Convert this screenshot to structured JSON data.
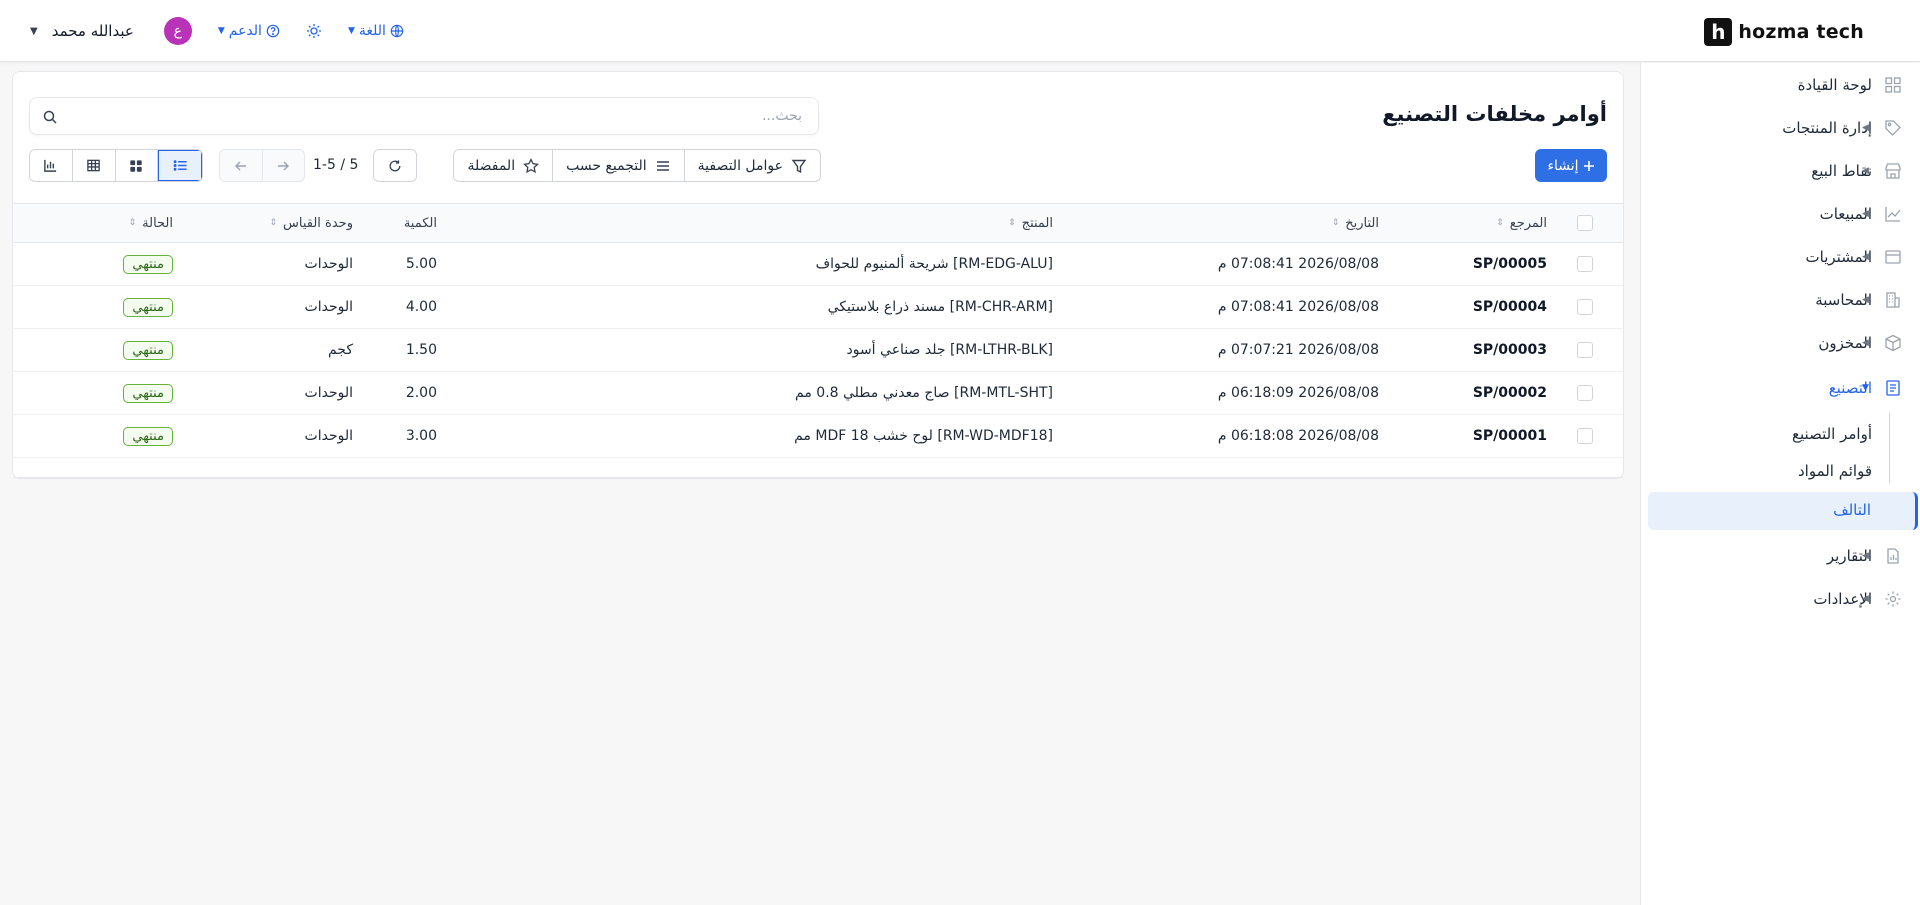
{
  "brand": {
    "logo_letter": "h",
    "name": "hozma tech"
  },
  "topbar": {
    "user_name": "عبدالله محمد",
    "avatar_letter": "ع",
    "support_label": "الدعم",
    "language_label": "اللغة"
  },
  "sidebar": {
    "items": [
      {
        "label": "لوحة القيادة",
        "icon": "grid-icon"
      },
      {
        "label": "إدارة المنتجات",
        "icon": "tag-icon"
      },
      {
        "label": "نقاط البيع",
        "icon": "store-icon"
      },
      {
        "label": "المبيعات",
        "icon": "chart-line-icon"
      },
      {
        "label": "المشتريات",
        "icon": "wallet-icon"
      },
      {
        "label": "المحاسبة",
        "icon": "building-icon"
      },
      {
        "label": "المخزون",
        "icon": "box-icon"
      },
      {
        "label": "التصنيع",
        "icon": "factory-icon",
        "active": true
      },
      {
        "label": "التقارير",
        "icon": "report-icon"
      },
      {
        "label": "الإعدادات",
        "icon": "gear-icon"
      }
    ],
    "manufacturing_sub": [
      "أوامر التصنيع",
      "قوائم المواد",
      "التالف"
    ]
  },
  "page": {
    "title": "أوامر مخلفات التصنيع",
    "search_placeholder": "بحث...",
    "create_label": "إنشاء",
    "filters_label": "عوامل التصفية",
    "group_by_label": "التجميع حسب",
    "favorites_label": "المفضلة",
    "pager": "1-5 / 5"
  },
  "table": {
    "columns": [
      "المرجع",
      "التاريخ",
      "المنتج",
      "الكمية",
      "وحدة القياس",
      "الحالة"
    ],
    "rows": [
      {
        "ref": "SP/00005",
        "date": "2026/08/08 07:08:41 م",
        "product": "[RM-EDG-ALU] شريحة ألمنيوم للحواف",
        "qty": "5.00",
        "uom": "الوحدات",
        "status": "منتهي"
      },
      {
        "ref": "SP/00004",
        "date": "2026/08/08 07:08:41 م",
        "product": "[RM-CHR-ARM] مسند ذراع بلاستيكي",
        "qty": "4.00",
        "uom": "الوحدات",
        "status": "منتهي"
      },
      {
        "ref": "SP/00003",
        "date": "2026/08/08 07:07:21 م",
        "product": "[RM-LTHR-BLK] جلد صناعي أسود",
        "qty": "1.50",
        "uom": "كجم",
        "status": "منتهي"
      },
      {
        "ref": "SP/00002",
        "date": "2026/08/08 06:18:09 م",
        "product": "[RM-MTL-SHT] صاج معدني مطلي 0.8 مم",
        "qty": "2.00",
        "uom": "الوحدات",
        "status": "منتهي"
      },
      {
        "ref": "SP/00001",
        "date": "2026/08/08 06:18:08 م",
        "product": "[RM-WD-MDF18] لوح خشب MDF 18 مم",
        "qty": "3.00",
        "uom": "الوحدات",
        "status": "منتهي"
      }
    ]
  },
  "colors": {
    "accent": "#2f6fe6",
    "status_done": "#65b33b",
    "avatar": "#b833b8"
  }
}
